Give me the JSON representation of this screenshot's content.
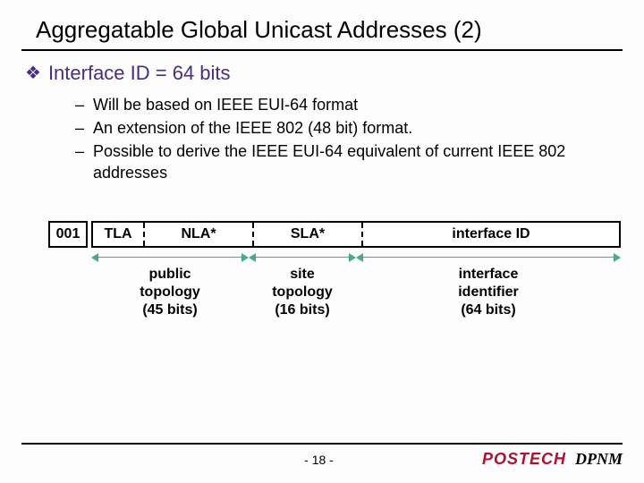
{
  "title": "Aggregatable Global Unicast Addresses (2)",
  "bullet": {
    "text": "Interface ID = 64 bits"
  },
  "sub": [
    "Will be based on IEEE EUI-64 format",
    "An extension of the IEEE 802 (48 bit) format.",
    "Possible to derive the IEEE EUI-64 equivalent of current IEEE 802 addresses"
  ],
  "diagram": {
    "prefix": "001",
    "fields": {
      "tla": "TLA",
      "nla": "NLA*",
      "sla": "SLA*",
      "ifid": "interface ID"
    },
    "spans": {
      "pub": {
        "l1": "public",
        "l2": "topology",
        "l3": "(45 bits)"
      },
      "site": {
        "l1": "site",
        "l2": "topology",
        "l3": "(16 bits)"
      },
      "intf": {
        "l1": "interface",
        "l2": "identifier",
        "l3": "(64 bits)"
      }
    }
  },
  "footer": {
    "page": "- 18 -",
    "postech": "POSTECH",
    "dpnm": "DPNM"
  }
}
